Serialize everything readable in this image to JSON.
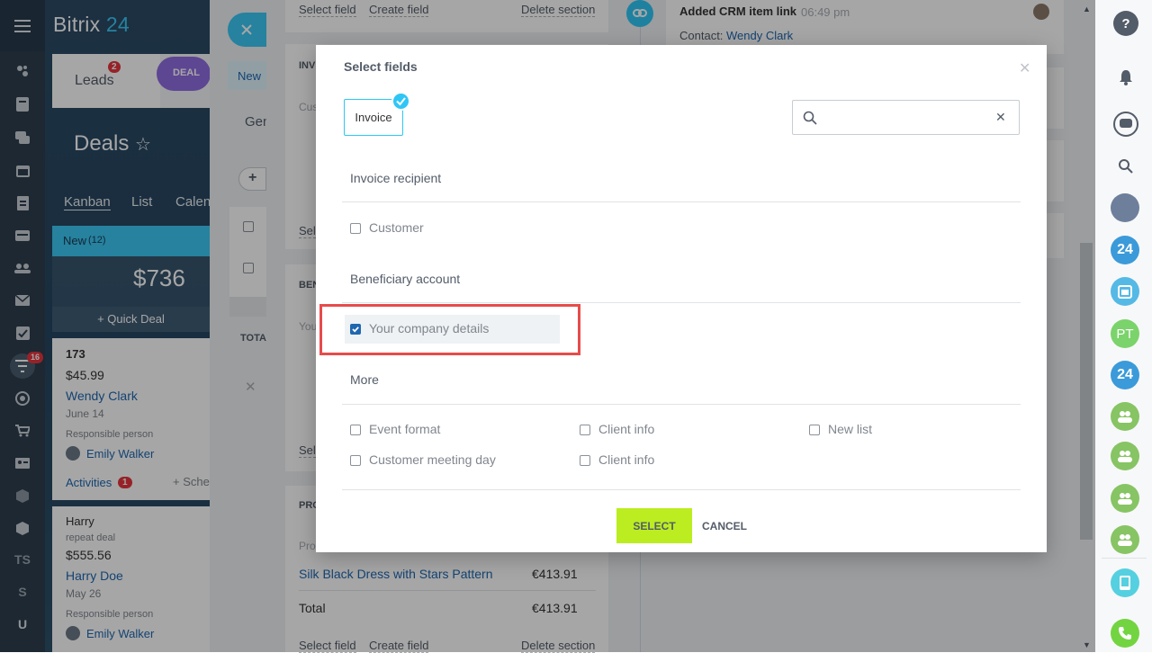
{
  "app": {
    "brand_name": "Bitrix",
    "brand_num": "24"
  },
  "leftnav": {
    "badge_feed": "16",
    "items": [
      "TS",
      "S",
      "U"
    ]
  },
  "crm": {
    "tab_leads": "Leads",
    "leads_badge": "2",
    "tab_deal": "DEAL",
    "page_title": "Deals",
    "view_tabs": [
      "Kanban",
      "List",
      "Calen"
    ],
    "stage_name": "New",
    "stage_count": "(12)",
    "stage_sum": "$736",
    "quick_deal": "+ Quick Deal",
    "card1": {
      "title": "173",
      "amount": "$45.99",
      "contact": "Wendy Clark",
      "date": "June 14",
      "resp_label": "Responsible person",
      "resp_name": "Emily Walker",
      "activities": "Activities",
      "activities_count": "1",
      "schedule": "+ Sche"
    },
    "card2": {
      "title": "Harry",
      "note": "repeat deal",
      "amount": "$555.56",
      "contact": "Harry Doe",
      "date": "May 26",
      "resp_label": "Responsible person",
      "resp_name": "Emily Walker"
    }
  },
  "slider": {
    "new_label": "New",
    "general_tab": "Gen",
    "section_links": {
      "select_field": "Select field",
      "create_field": "Create field",
      "delete_section": "Delete section"
    },
    "inv_heading": "INV",
    "cus_label": "Cus",
    "sel_short": "Sel",
    "ben_heading": "BEN",
    "you_label": "You",
    "total_short": "TOTAL",
    "pro_heading": "PRO",
    "pro_label": "Pro",
    "product_name": "Silk Black Dress with Stars Pattern",
    "product_price": "€413.91",
    "total_label": "Total",
    "total_value": "€413.91"
  },
  "timeline": {
    "event_title": "Added CRM item link",
    "event_time": "06:49 pm",
    "contact_label": "Contact:",
    "contact_name": "Wendy Clark"
  },
  "rightbar": {
    "pt": "PT",
    "b24": "24"
  },
  "modal": {
    "title": "Select fields",
    "entity_tag": "Invoice",
    "search_placeholder": "",
    "sections": [
      {
        "heading": "Invoice recipient",
        "fields": [
          {
            "label": "Customer",
            "checked": false
          }
        ]
      },
      {
        "heading": "Beneficiary account",
        "fields": [
          {
            "label": "Your company details",
            "checked": true
          }
        ]
      },
      {
        "heading": "More",
        "fields": [
          {
            "label": "Event format",
            "checked": false
          },
          {
            "label": "Client info",
            "checked": false
          },
          {
            "label": "New list",
            "checked": false
          },
          {
            "label": "Customer meeting day",
            "checked": false
          },
          {
            "label": "Client info",
            "checked": false
          }
        ]
      }
    ],
    "select_label": "SELECT",
    "cancel_label": "CANCEL"
  },
  "colors": {
    "accent": "#2fc6f6",
    "select_button": "#bbed21",
    "highlight": "#e84b4b",
    "link": "#2067b0"
  }
}
